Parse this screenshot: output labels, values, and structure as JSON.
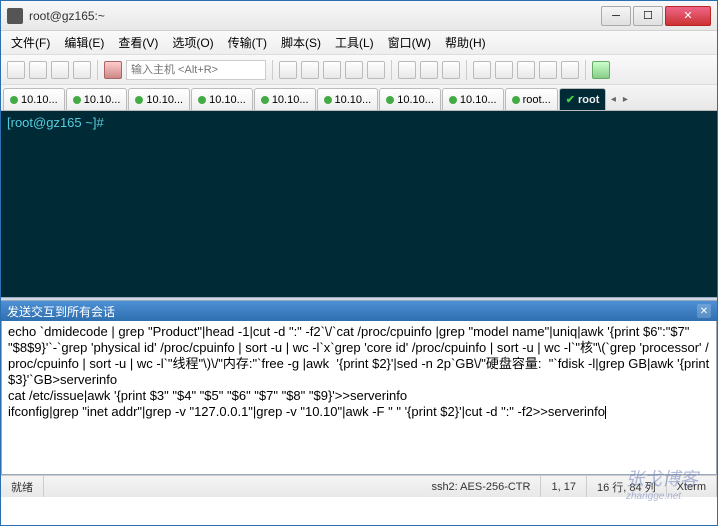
{
  "window": {
    "title": "root@gz165:~"
  },
  "menu": {
    "file": "文件(F)",
    "edit": "编辑(E)",
    "view": "查看(V)",
    "options": "选项(O)",
    "transfer": "传输(T)",
    "script": "脚本(S)",
    "tools": "工具(L)",
    "window": "窗口(W)",
    "help": "帮助(H)"
  },
  "toolbar": {
    "host_placeholder": "输入主机 <Alt+R>"
  },
  "tabs": {
    "items": [
      {
        "label": "10.10..."
      },
      {
        "label": "10.10..."
      },
      {
        "label": "10.10..."
      },
      {
        "label": "10.10..."
      },
      {
        "label": "10.10..."
      },
      {
        "label": "10.10..."
      },
      {
        "label": "10.10..."
      },
      {
        "label": "10.10..."
      },
      {
        "label": "root..."
      }
    ],
    "active": "root"
  },
  "terminal": {
    "prompt": "[root@gz165 ~]#"
  },
  "panel": {
    "title": "发送交互到所有会话",
    "command": "echo `dmidecode | grep \"Product\"|head -1|cut -d \":\" -f2`\\/`cat /proc/cpuinfo |grep \"model name\"|uniq|awk '{print $6\":\"$7\" \"$8$9}'`-`grep 'physical id' /proc/cpuinfo | sort -u | wc -l`x`grep 'core id' /proc/cpuinfo | sort -u | wc -l`\"核\"\\(`grep 'processor' /proc/cpuinfo | sort -u | wc -l`\"线程\"\\)\\/\"内存:\"`free -g |awk  '{print $2}'|sed -n 2p`GB\\/\"硬盘容量:  \"`fdisk -l|grep GB|awk '{print $3}'`GB>serverinfo\ncat /etc/issue|awk '{print $3\" \"$4\" \"$5\" \"$6\" \"$7\" \"$8\" \"$9}'>>serverinfo\nifconfig|grep \"inet addr\"|grep -v \"127.0.0.1\"|grep -v \"10.10\"|awk -F \" \" '{print $2}'|cut -d \":\" -f2>>serverinfo"
  },
  "status": {
    "ready": "就绪",
    "cipher": "ssh2: AES-256-CTR",
    "pos": "1,  17",
    "size": "16 行, 84 列",
    "term": "Xterm"
  },
  "watermark": {
    "main": "张戈博客",
    "sub": "zhangge.net"
  }
}
